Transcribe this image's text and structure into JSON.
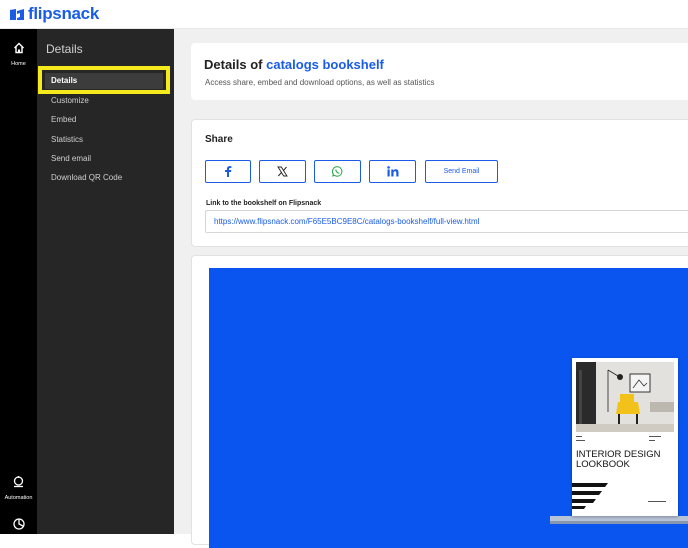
{
  "brand": {
    "name": "flipsnack",
    "color": "#1a5ce6"
  },
  "rail": {
    "home_label": "Home",
    "automation_label": "Automation",
    "icons": [
      "home-icon",
      "automation-icon",
      "clock-icon"
    ]
  },
  "sidebar": {
    "title": "Details",
    "items": [
      {
        "label": "Details",
        "active": true
      },
      {
        "label": "Customize"
      },
      {
        "label": "Embed"
      },
      {
        "label": "Statistics"
      },
      {
        "label": "Send email"
      },
      {
        "label": "Download QR Code"
      }
    ]
  },
  "header": {
    "title_prefix": "Details of",
    "title_name": "catalogs bookshelf",
    "subtitle": "Access share, embed and download options, as well as statistics"
  },
  "share": {
    "title": "Share",
    "buttons": [
      "facebook-icon",
      "x-icon",
      "whatsapp-icon",
      "linkedin-icon"
    ],
    "send_email_label": "Send Email",
    "link_label": "Link to the bookshelf on Flipsnack",
    "link_value": "https://www.flipsnack.com/F65E5BC9E8C/catalogs-bookshelf/full-view.html"
  },
  "preview": {
    "background": "#0a55f0",
    "book_title": "INTERIOR DESIGN LOOKBOOK"
  },
  "colors": {
    "highlight": "#f5ea1b",
    "accent": "#1a5ce6",
    "whatsapp": "#2aa64a"
  }
}
